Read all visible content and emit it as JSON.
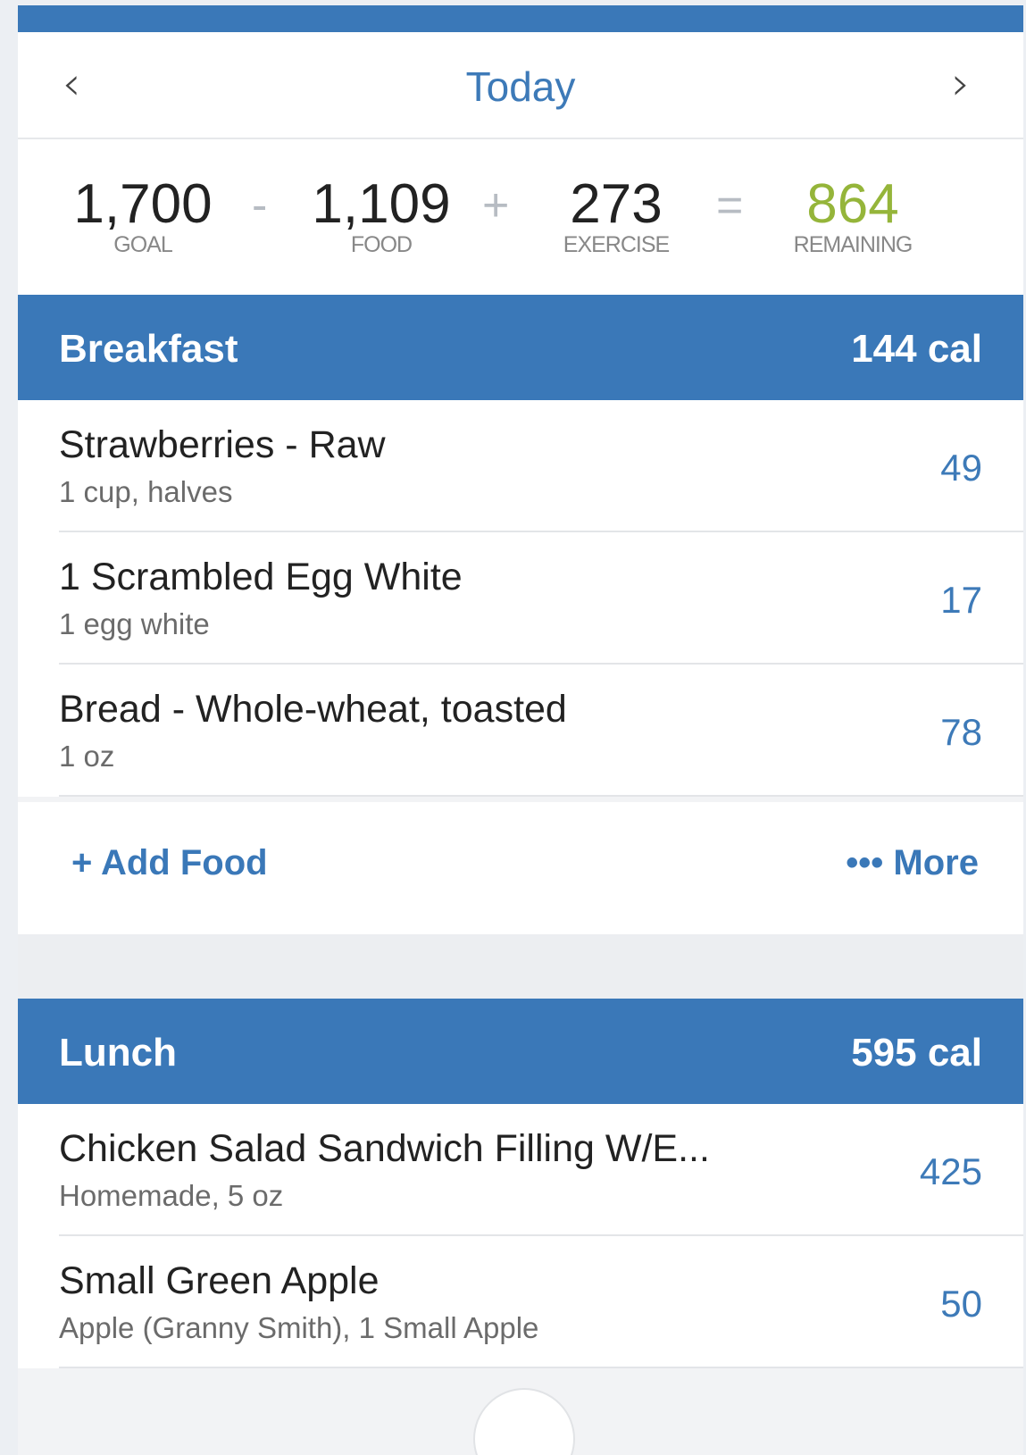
{
  "date_nav": {
    "title": "Today",
    "prev_icon": "‹",
    "next_icon": "›"
  },
  "summary": {
    "goal": {
      "value": "1,700",
      "label": "GOAL"
    },
    "minus": "-",
    "food": {
      "value": "1,109",
      "label": "FOOD"
    },
    "plus": "+",
    "exercise": {
      "value": "273",
      "label": "EXERCISE"
    },
    "equals": "=",
    "remaining": {
      "value": "864",
      "label": "REMAINING"
    }
  },
  "meals": {
    "breakfast": {
      "name": "Breakfast",
      "calories": "144 cal",
      "items": [
        {
          "name": "Strawberries - Raw",
          "desc": "1 cup, halves",
          "cal": "49"
        },
        {
          "name": "1 Scrambled Egg White",
          "desc": "1 egg white",
          "cal": "17"
        },
        {
          "name": "Bread - Whole-wheat, toasted",
          "desc": "1 oz",
          "cal": "78"
        }
      ],
      "add_label": "+ Add Food",
      "more_label": "••• More"
    },
    "lunch": {
      "name": "Lunch",
      "calories": "595 cal",
      "items": [
        {
          "name": "Chicken Salad Sandwich Filling W/E...",
          "desc": "Homemade, 5 oz",
          "cal": "425"
        },
        {
          "name": "Small Green Apple",
          "desc": "Apple (Granny Smith), 1 Small Apple",
          "cal": "50"
        }
      ]
    }
  },
  "colors": {
    "header_blue": "#3a78b8",
    "remaining_green": "#95b53a",
    "calorie_blue": "#3d7ab8"
  }
}
